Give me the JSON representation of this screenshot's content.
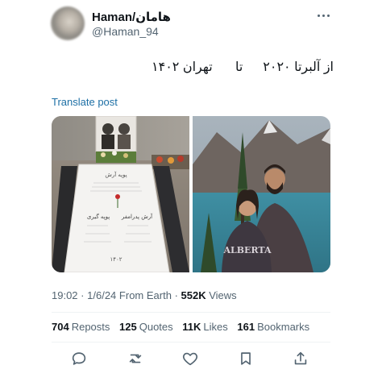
{
  "author": {
    "display_name": "Haman/هامان",
    "handle": "@Haman_94",
    "avatar_icon": "avatar-blurred"
  },
  "tweet": {
    "text_part1": "از آلبرتا ۲۰۲۰",
    "text_part2": "تا",
    "text_part3": "تهران ۱۴۰۲",
    "translate_label": "Translate post"
  },
  "media": {
    "left_image": {
      "description_icon": "gravestone-photo",
      "gravestone_top_label": "پوپه آرش",
      "gravestone_name_left": "آرش پدرامفر",
      "gravestone_name_right": "پوپه گیری",
      "gravestone_date": "۱۴۰۲"
    },
    "right_image": {
      "description_icon": "couple-photo",
      "hoodie_text": "ALBERTA"
    }
  },
  "meta": {
    "time": "19:02",
    "date": "1/6/24",
    "source": "From Earth",
    "views_count": "552K",
    "views_label": "Views"
  },
  "stats": {
    "reposts_count": "704",
    "reposts_label": "Reposts",
    "quotes_count": "125",
    "quotes_label": "Quotes",
    "likes_count": "11K",
    "likes_label": "Likes",
    "bookmarks_count": "161",
    "bookmarks_label": "Bookmarks"
  },
  "actions": {
    "reply_icon": "reply-icon",
    "repost_icon": "repost-icon",
    "like_icon": "heart-icon",
    "bookmark_icon": "bookmark-icon",
    "share_icon": "share-icon"
  },
  "colors": {
    "text_primary": "#0f1419",
    "text_secondary": "#536471",
    "link": "#1d6fa5",
    "divider": "#eff3f4"
  }
}
